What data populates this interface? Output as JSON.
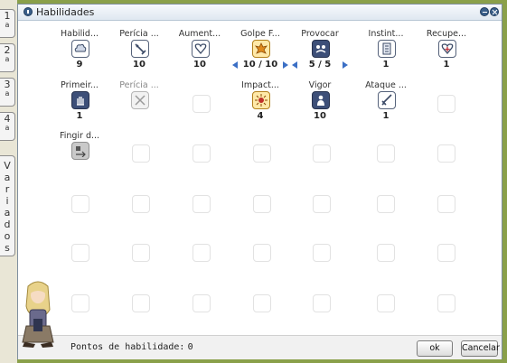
{
  "window": {
    "title": "Habilidades"
  },
  "tabs": [
    {
      "label": "1",
      "sup": "a"
    },
    {
      "label": "2",
      "sup": "a"
    },
    {
      "label": "3",
      "sup": "a"
    },
    {
      "label": "4",
      "sup": "a"
    },
    {
      "label": "Variados"
    }
  ],
  "skills": {
    "r0c0": {
      "name": "Habilid...",
      "level": "9",
      "icon": "cloud-icon"
    },
    "r0c1": {
      "name": "Perícia ...",
      "level": "10",
      "icon": "sword-icon"
    },
    "r0c2": {
      "name": "Aument...",
      "level": "10",
      "icon": "heart-icon"
    },
    "r0c3": {
      "name": "Golpe F...",
      "level": "10 / 10",
      "icon": "fire-burst-icon"
    },
    "r0c4": {
      "name": "Provocar",
      "level": "5 / 5",
      "icon": "provoke-icon"
    },
    "r0c5": {
      "name": "Instint...",
      "level": "1",
      "icon": "scroll-icon"
    },
    "r0c6": {
      "name": "Recupe...",
      "level": "1",
      "icon": "heart-plus-icon"
    },
    "r1c0": {
      "name": "Primeir...",
      "level": "1",
      "icon": "hand-icon"
    },
    "r1c1": {
      "name": "Perícia ...",
      "level": "",
      "icon": "crossed-swords-icon"
    },
    "r1c3": {
      "name": "Impact...",
      "level": "4",
      "icon": "impact-icon"
    },
    "r1c4": {
      "name": "Vigor",
      "level": "10",
      "icon": "figure-icon"
    },
    "r1c5": {
      "name": "Ataque ...",
      "level": "1",
      "icon": "dagger-icon"
    },
    "r2c0": {
      "name": "Fingir d...",
      "level": "",
      "icon": "fake-death-icon"
    }
  },
  "footer": {
    "points_label": "Pontos de habilidade:",
    "points_value": "0",
    "ok_label": "ok",
    "cancel_label": "Cancelar"
  },
  "colors": {
    "titlebar": "#dfe8f1",
    "accent": "#3b6fc5",
    "background": "#8aa04a"
  }
}
